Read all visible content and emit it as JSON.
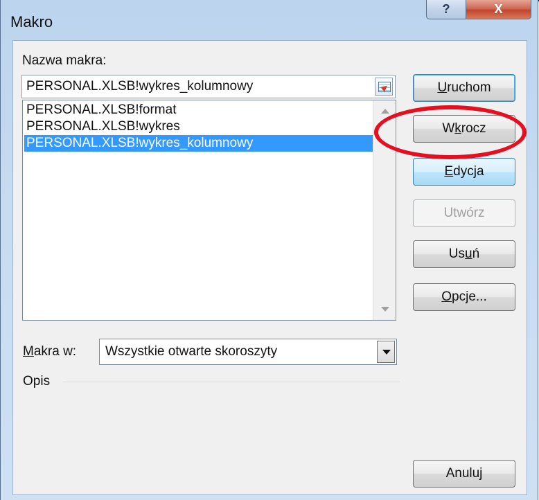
{
  "window": {
    "title": "Makro",
    "help_glyph": "?",
    "close_glyph": "X"
  },
  "macro_name": {
    "label": "Nazwa makra:",
    "value": "PERSONAL.XLSB!wykres_kolumnowy"
  },
  "macro_list": [
    {
      "label": "PERSONAL.XLSB!format",
      "selected": false
    },
    {
      "label": "PERSONAL.XLSB!wykres",
      "selected": false
    },
    {
      "label": "PERSONAL.XLSB!wykres_kolumnowy",
      "selected": true
    }
  ],
  "buttons": {
    "run": {
      "pre": "",
      "mn": "U",
      "post": "ruchom"
    },
    "step": {
      "pre": "W",
      "mn": "k",
      "post": "rocz"
    },
    "edit": {
      "pre": "",
      "mn": "E",
      "post": "dycja"
    },
    "create": {
      "label": "Utwórz",
      "disabled": true
    },
    "delete": {
      "pre": "Us",
      "mn": "u",
      "post": "ń"
    },
    "options": {
      "pre": "",
      "mn": "O",
      "post": "pcje..."
    },
    "cancel": {
      "label": "Anuluj"
    }
  },
  "macros_in": {
    "label_mn": "M",
    "label_rest": "akra w:",
    "value": "Wszystkie otwarte skoroszyty"
  },
  "description": {
    "label": "Opis"
  },
  "annotation": {
    "color": "#e4101f",
    "highlights": "edit-button"
  },
  "colors": {
    "selection": "#3399ff",
    "frame": "#c7dbf1",
    "close_button": "#c2452c"
  },
  "icons": {
    "collapse": "collapse-dialog-icon",
    "scroll_up": "scroll-up-icon",
    "scroll_down": "scroll-down-icon",
    "dropdown": "chevron-down-icon"
  }
}
